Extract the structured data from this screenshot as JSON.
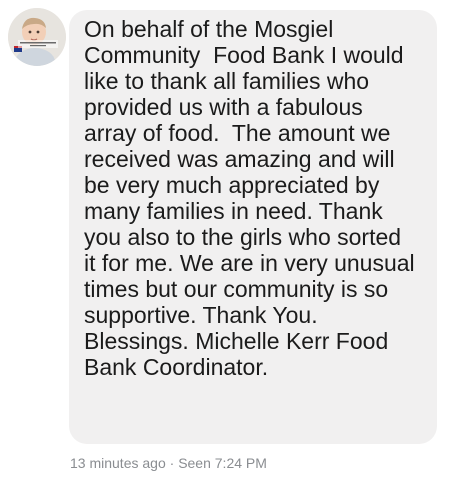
{
  "message": {
    "lines": [
      "On behalf of the Mosgiel",
      "Community  Food Bank I would",
      "like to thank all families who",
      "provided us with a fabulous",
      "array of food.  The amount we",
      "received was amazing and will",
      "be very much appreciated by",
      "many families in need. Thank",
      "you also to the girls who sorted",
      "it for me. We are in very unusual",
      "times but our community is so",
      "supportive. Thank You.",
      "Blessings. Michelle Kerr Food",
      "Bank Coordinator."
    ]
  },
  "meta": {
    "time": "13 minutes ago",
    "separator": " · ",
    "seen": "Seen 7:24 PM"
  },
  "colors": {
    "bubble": "#f1f0f0",
    "text": "#1b1b1b",
    "meta": "#8a8d91"
  },
  "icons": {
    "avatar": "user-avatar-baby-photo"
  }
}
